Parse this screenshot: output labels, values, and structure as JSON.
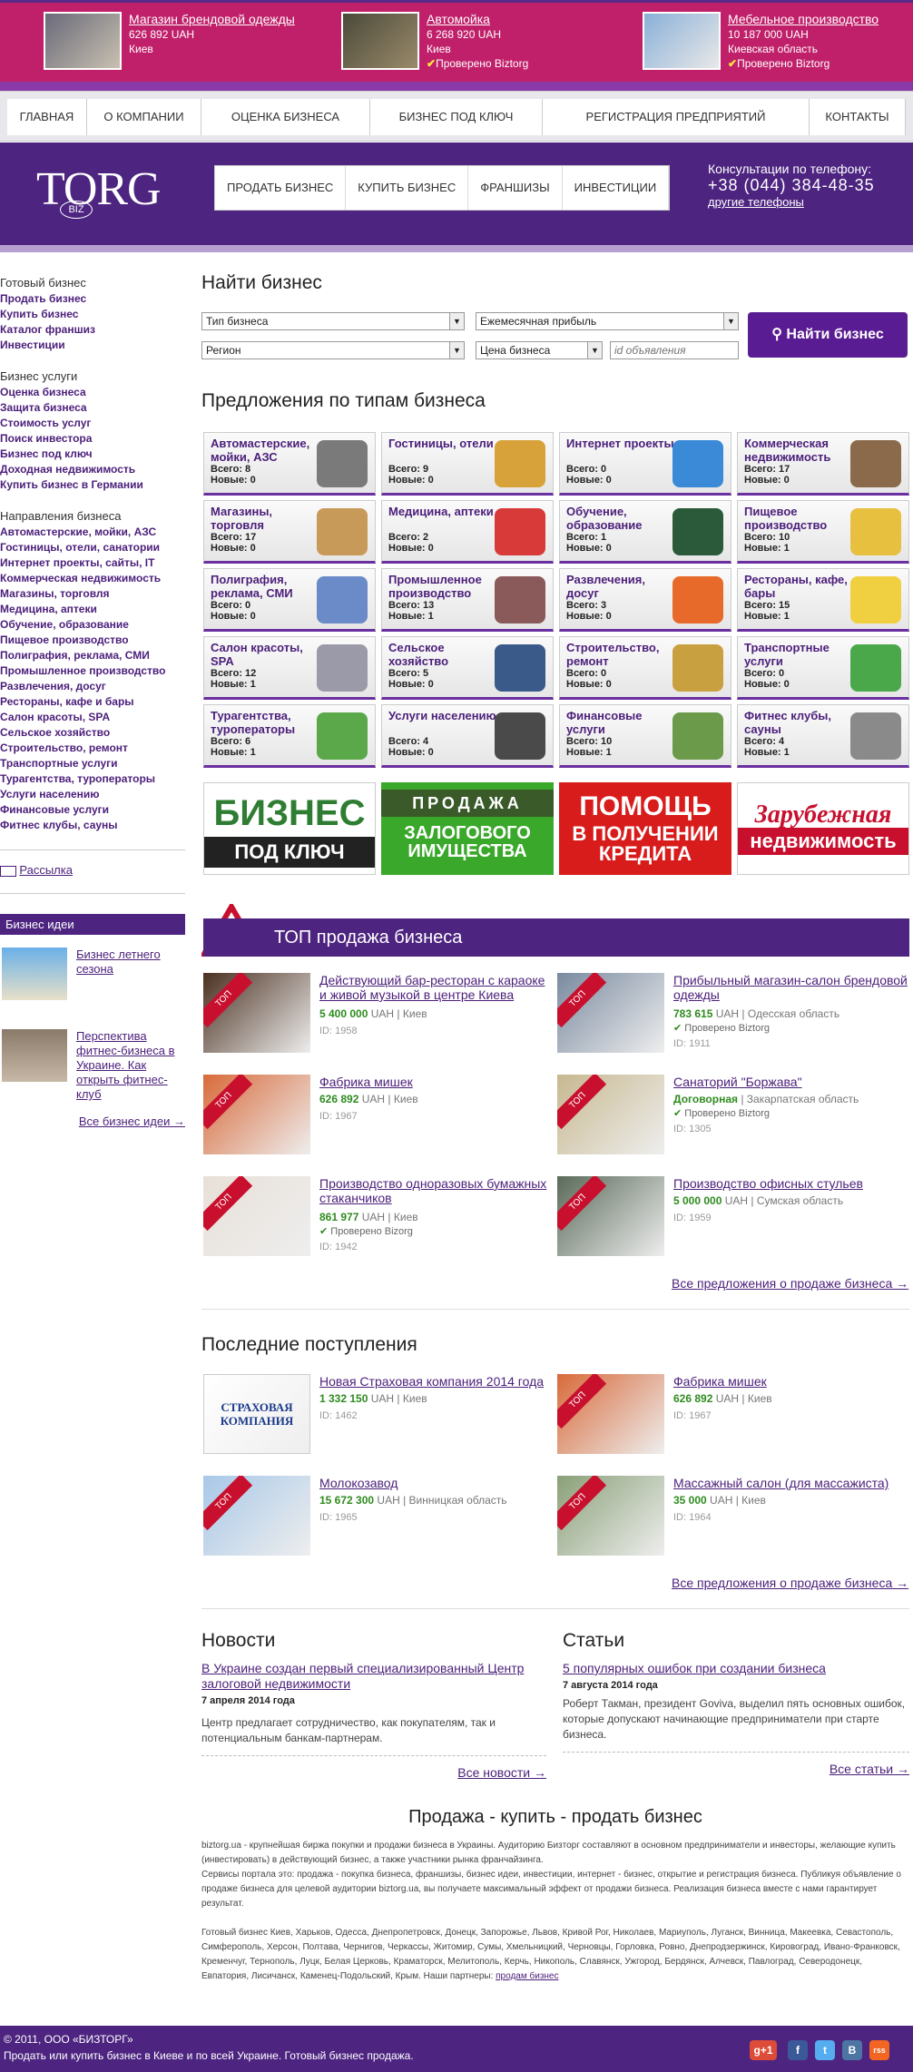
{
  "topads": [
    {
      "title": "Магазин брендовой одежды",
      "price": "626 892 UAH",
      "place": "Киев",
      "verified": ""
    },
    {
      "title": "Автомойка",
      "price": "6 268 920 UAH",
      "place": "Киев",
      "verified": "Проверено Biztorg"
    },
    {
      "title": "Мебельное производство",
      "price": "10 187 000 UAH",
      "place": "Киевская область",
      "verified": "Проверено Biztorg"
    }
  ],
  "nav": [
    "ГЛАВНАЯ",
    "О КОМПАНИИ",
    "ОЦЕНКА БИЗНЕСА",
    "БИЗНЕС ПОД КЛЮЧ",
    "РЕГИСТРАЦИЯ ПРЕДПРИЯТИЙ",
    "КОНТАКТЫ"
  ],
  "logo": {
    "main": "TORG",
    "small": "BIZ"
  },
  "subnav": [
    "ПРОДАТЬ БИЗНЕС",
    "КУПИТЬ БИЗНЕС",
    "ФРАНШИЗЫ",
    "ИНВЕСТИЦИИ"
  ],
  "phone": {
    "label": "Консультации по телефону:",
    "number": "+38 (044) 384-48-35",
    "other": "другие телефоны"
  },
  "left": {
    "ready_h": "Готовый бизнес",
    "ready": [
      "Продать бизнес",
      "Купить бизнес",
      "Каталог франшиз",
      "Инвестиции"
    ],
    "services_h": "Бизнес услуги",
    "services": [
      "Оценка бизнеса",
      "Защита бизнеса",
      "Стоимость услуг",
      "Поиск инвестора",
      "Бизнес под ключ",
      "Доходная недвижимость",
      "Купить бизнес в Германии"
    ],
    "dirs_h": "Направления бизнеса",
    "dirs": [
      "Автомастерские, мойки, АЗС",
      "Гостиницы, отели, санатории",
      "Интернет проекты, сайты, IT",
      "Коммерческая недвижимость",
      "Магазины, торговля",
      "Медицина, аптеки",
      "Обучение, образование",
      "Пищевое производство",
      "Полиграфия, реклама, СМИ",
      "Промышленное производство",
      "Развлечения, досуг",
      "Рестораны, кафе и бары",
      "Салон красоты, SPA",
      "Сельское хозяйство",
      "Строительство, ремонт",
      "Транспортные услуги",
      "Турагентства, туроператоры",
      "Услуги населению",
      "Финансовые услуги",
      "Фитнес клубы, сауны"
    ],
    "newsletter": "Рассылка",
    "ideas_h": "Бизнес идеи",
    "ideas": [
      "Бизнес летнего сезона",
      "Перспектива фитнес-бизнеса в Украине. Как открыть фитнес-клуб"
    ],
    "ideas_all": "Все бизнес идеи →"
  },
  "search": {
    "title": "Найти бизнес",
    "type": "Тип бизнеса",
    "profit": "Ежемесячная прибыль",
    "region": "Регион",
    "price": "Цена бизнеса",
    "id_ph": "id объявления",
    "button": "Найти бизнес"
  },
  "types_title": "Предложения по типам бизнеса",
  "tiles": [
    {
      "name": "Автомастерские, мойки, АЗС",
      "all": "Всего: 8",
      "new": "Новые: 0",
      "color": "#7a7a7a"
    },
    {
      "name": "Гостиницы, отели",
      "all": "Всего: 9",
      "new": "Новые: 0",
      "color": "#d8a23a"
    },
    {
      "name": "Интернет проекты",
      "all": "Всего: 0",
      "new": "Новые: 0",
      "color": "#3a8ad8"
    },
    {
      "name": "Коммерческая недвижимость",
      "all": "Всего: 17",
      "new": "Новые: 0",
      "color": "#8a6a4a"
    },
    {
      "name": "Магазины, торговля",
      "all": "Всего: 17",
      "new": "Новые: 0",
      "color": "#c89a5a"
    },
    {
      "name": "Медицина, аптеки",
      "all": "Всего: 2",
      "new": "Новые: 0",
      "color": "#d83a3a"
    },
    {
      "name": "Обучение, образование",
      "all": "Всего: 1",
      "new": "Новые: 0",
      "color": "#2a5a3a"
    },
    {
      "name": "Пищевое производство",
      "all": "Всего: 10",
      "new": "Новые: 1",
      "color": "#e8c040"
    },
    {
      "name": "Полиграфия, реклама, СМИ",
      "all": "Всего: 0",
      "new": "Новые: 0",
      "color": "#6a8ac8"
    },
    {
      "name": "Промышленное производство",
      "all": "Всего: 13",
      "new": "Новые: 1",
      "color": "#8a5a5a"
    },
    {
      "name": "Развлечения, досуг",
      "all": "Всего: 3",
      "new": "Новые: 0",
      "color": "#e86a2a"
    },
    {
      "name": "Рестораны, кафе, бары",
      "all": "Всего: 15",
      "new": "Новые: 1",
      "color": "#f0d040"
    },
    {
      "name": "Салон красоты, SPA",
      "all": "Всего: 12",
      "new": "Новые: 1",
      "color": "#9a9aa8"
    },
    {
      "name": "Сельское хозяйство",
      "all": "Всего: 5",
      "new": "Новые: 0",
      "color": "#3a5a8a"
    },
    {
      "name": "Строительство, ремонт",
      "all": "Всего: 0",
      "new": "Новые: 0",
      "color": "#c8a040"
    },
    {
      "name": "Транспортные услуги",
      "all": "Всего: 0",
      "new": "Новые: 0",
      "color": "#4aa84a"
    },
    {
      "name": "Турагентства, туроператоры",
      "all": "Всего: 6",
      "new": "Новые: 1",
      "color": "#5aa84a"
    },
    {
      "name": "Услуги населению",
      "all": "Всего: 4",
      "new": "Новые: 0",
      "color": "#4a4a4a"
    },
    {
      "name": "Финансовые услуги",
      "all": "Всего: 10",
      "new": "Новые: 1",
      "color": "#6a9a4a"
    },
    {
      "name": "Фитнес клубы, сауны",
      "all": "Всего: 4",
      "new": "Новые: 1",
      "color": "#8a8a8a"
    }
  ],
  "banners": [
    {
      "l1": "БИЗНЕС",
      "l2": "ПОД КЛЮЧ",
      "bg": "#2e7d32",
      "fg": "#fff"
    },
    {
      "l1": "ПРОДАЖА",
      "l2": "ЗАЛОГОВОГО ИМУЩЕСТВА",
      "bg": "#3aa82a",
      "fg": "#fff"
    },
    {
      "l1": "ПОМОЩЬ",
      "l2": "В ПОЛУЧЕНИИ КРЕДИТА",
      "bg": "#d81c1c",
      "fg": "#fff"
    },
    {
      "l1": "Зарубежная",
      "l2": "недвижимость",
      "bg": "#ffffff",
      "fg": "#c8102e"
    }
  ],
  "top": {
    "title": "ТОП продажа бизнеса",
    "tag": "ТОП",
    "more": "Все предложения о продаже бизнеса →",
    "items": [
      {
        "title": "Действующий бар-ресторан с караоке и живой музыкой в центре Киева",
        "price": "5 400 000",
        "cur": "UAH",
        "place": "| Киев",
        "verified": "",
        "id": "ID: 1958",
        "color": "#4a3020"
      },
      {
        "title": "Прибыльный магазин-салон брендовой одежды",
        "price": "783 615",
        "cur": "UAH",
        "place": "| Одесская область",
        "verified": "Проверено Biztorg",
        "id": "ID: 1911",
        "color": "#7a8aa0"
      },
      {
        "title": "Фабрика мишек",
        "price": "626 892",
        "cur": "UAH",
        "place": "| Киев",
        "verified": "",
        "id": "ID: 1967",
        "color": "#d86a3a"
      },
      {
        "title": "Санаторий \"Боржава\"",
        "price": "Договорная",
        "cur": "",
        "place": "| Закарпатская область",
        "verified": "Проверено Biztorg",
        "id": "ID: 1305",
        "color": "#c8b890"
      },
      {
        "title": "Производство одноразовых бумажных стаканчиков",
        "price": "861 977",
        "cur": "UAH",
        "place": "| Киев",
        "verified": "Проверено Bizorg",
        "id": "ID: 1942",
        "color": "#e8e0d8"
      },
      {
        "title": "Производство офисных стульев",
        "price": "5 000 000",
        "cur": "UAH",
        "place": "| Сумская область",
        "verified": "",
        "id": "ID: 1959",
        "color": "#5a6a5a"
      }
    ]
  },
  "latest": {
    "title": "Последние поступления",
    "more": "Все предложения о продаже бизнеса →",
    "items": [
      {
        "title": "Новая Страховая компания 2014 года",
        "price": "1 332 150",
        "cur": "UAH",
        "place": "| Киев",
        "id": "ID: 1462",
        "color": "#ffffff",
        "tag": "",
        "logo": "СТРАХОВАЯ КОМПАНИЯ"
      },
      {
        "title": "Фабрика мишек",
        "price": "626 892",
        "cur": "UAH",
        "place": "| Киев",
        "id": "ID: 1967",
        "color": "#d86a3a",
        "tag": "ТОП",
        "logo": ""
      },
      {
        "title": "Молокозавод",
        "price": "15 672 300",
        "cur": "UAH",
        "place": "| Винницкая область",
        "id": "ID: 1965",
        "color": "#a8c8e8",
        "tag": "ТОП",
        "logo": ""
      },
      {
        "title": "Массажный салон (для массажиста)",
        "price": "35 000",
        "cur": "UAH",
        "place": "| Киев",
        "id": "ID: 1964",
        "color": "#8aa078",
        "tag": "ТОП",
        "logo": ""
      }
    ]
  },
  "news": {
    "title": "Новости",
    "head": "В Украине создан первый специализированный Центр залоговой недвижимости",
    "date": "7 апреля 2014 года",
    "text": "Центр предлагает сотрудничество, как покупателям, так и потенциальным банкам-партнерам.",
    "more": "Все новости →"
  },
  "articles": {
    "title": "Статьи",
    "head": "5 популярных ошибок при создании бизнеса",
    "date": "7 августа 2014 года",
    "text": "Роберт Такман, президент Goviva, выделил пять основных ошибок, которые допускают начинающие предприниматели при старте бизнеса.",
    "more": "Все статьи →"
  },
  "seo": {
    "title": "Продажа - купить - продать бизнес",
    "p1": "biztorg.ua - крупнейшая биржа покупки и продажи бизнеса в Украины. Аудиторию Бизторг составляют в основном предприниматели и инвесторы, желающие купить (инвестировать) в действующий бизнес, а также участники рынка франчайзинга.",
    "p2": "Сервисы портала это: продажа - покупка бизнеса, франшизы, бизнес идеи, инвестиции, интернет - бизнес, открытие и регистрация бизнеса. Публикуя объявление о продаже бизнеса для целевой аудитории biztorg.ua, вы получаете максимальный эффект от продажи бизнеса. Реализация бизнеса вместе с нами гарантирует результат.",
    "p3": "Готовый бизнес Киев, Харьков, Одесса, Днепропетровск, Донецк, Запорожье, Львов, Кривой Рог, Николаев, Мариуполь, Луганск, Винница, Макеевка, Севастополь, Симферополь, Херсон, Полтава, Чернигов, Черкассы, Житомир, Сумы, Хмельницкий, Черновцы, Горловка, Ровно, Днепродзержинск, Кировоград, Ивано-Франковск, Кременчуг, Тернополь, Луцк, Белая Церковь, Краматорск, Мелитополь, Керчь, Никополь, Славянск, Ужгород, Бердянск, Алчевск, Павлоград, Северодонецк, Евпатория, Лисичанск, Каменец-Подольский, Крым. Наши партнеры:",
    "partner": "продам бизнес"
  },
  "footer": {
    "copy": "© 2011, ООО «БИЗТОРГ»",
    "desc": "Продать или купить бизнес в Киеве и по всей Украине. Готовый бизнес продажа."
  },
  "social": [
    {
      "t": "g+1",
      "c": "#dd4b39"
    },
    {
      "t": "f",
      "c": "#3b5998"
    },
    {
      "t": "t",
      "c": "#55acee"
    },
    {
      "t": "B",
      "c": "#4c75a3"
    },
    {
      "t": "rss",
      "c": "#f26522"
    }
  ]
}
